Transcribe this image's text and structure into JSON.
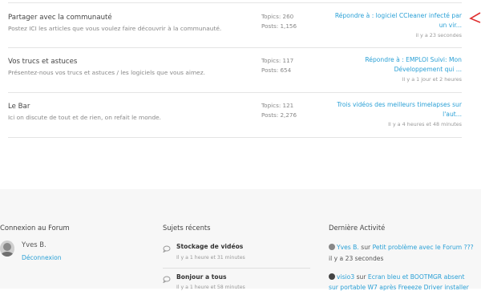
{
  "forums": [
    {
      "title": "Partager avec la communauté",
      "description": "Postez ICI les articles que vous voulez faire découvrir à la communauté.",
      "topics": "Topics: 260",
      "posts": "Posts: 1,156",
      "last_post": "Répondre à : logiciel CCleaner infecté par un vir...",
      "last_time": "il y a 23 secondes"
    },
    {
      "title": "Vos trucs et astuces",
      "description": "Présentez-nous vos trucs et astuces / les logiciels que vous aimez.",
      "topics": "Topics: 117",
      "posts": "Posts: 654",
      "last_post": "Répondre à : EMPLOI Suivi: Mon Développement qui ...",
      "last_time": "Il y a 1 jour et 2 heures"
    },
    {
      "title": "Le Bar",
      "description": "Ici on discute de tout et de rien, on refait le monde.",
      "topics": "Topics: 121",
      "posts": "Posts: 2,276",
      "last_post": "Trois vidéos des meilleurs timelapses sur l'aut...",
      "last_time": "Il y a 4 heures et 48 minutes"
    }
  ],
  "footer": {
    "login_title": "Connexion au Forum",
    "user_name": "Yves B.",
    "logout_label": "Déconnexion",
    "recent_title": "Sujets récents",
    "recent_topics": [
      {
        "title": "Stockage de vidéos",
        "time": "Il y a 1 heure et 31 minutes"
      },
      {
        "title": "Bonjour a tous",
        "time": "Il y a 1 heure et 58 minutes"
      }
    ],
    "activity_title": "Dernière Activité",
    "activity": [
      {
        "user": "Yves B.",
        "word": "sur",
        "topic": "Petit problème avec le Forum ???",
        "time": "il y a 23 secondes"
      },
      {
        "user": "visio3",
        "word": "sur",
        "topic": "Ecran bleu et BOOTMGR absent",
        "continuation": "sur portable W7 après Freeeze Driver installer"
      }
    ]
  },
  "colors": {
    "link": "#2aa0d6",
    "arrow": "#e03030",
    "footer_bg": "#f7f7f7"
  }
}
